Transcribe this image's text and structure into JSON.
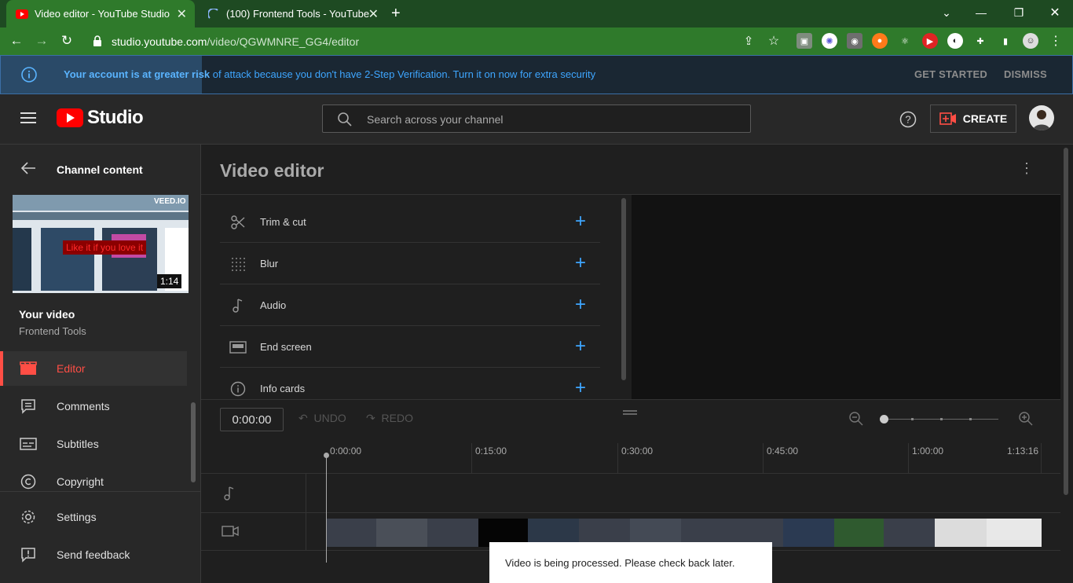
{
  "browser": {
    "tabs": [
      {
        "title": "Video editor - YouTube Studio",
        "active": true
      },
      {
        "title": "(100) Frontend Tools - YouTube",
        "active": false
      }
    ],
    "url_host": "studio.youtube.com",
    "url_path": "/video/QGWMNRE_GG4/editor"
  },
  "banner": {
    "strong": "Your account is at greater risk",
    "rest": " of attack because you don't have 2-Step Verification. Turn it on now for extra security",
    "get_started": "GET STARTED",
    "dismiss": "DISMISS"
  },
  "header": {
    "logo_text": "Studio",
    "search_placeholder": "Search across your channel",
    "create_label": "CREATE"
  },
  "sidebar": {
    "back_title": "Channel content",
    "thumb_brand": "VEED.IO",
    "thumb_overlay": "Like it if you love it",
    "thumb_duration": "1:14",
    "video_label": "Your video",
    "channel_name": "Frontend Tools",
    "items": [
      {
        "label": "Editor",
        "icon": "editor-icon",
        "active": true
      },
      {
        "label": "Comments",
        "icon": "comments-icon",
        "active": false
      },
      {
        "label": "Subtitles",
        "icon": "subtitles-icon",
        "active": false
      },
      {
        "label": "Copyright",
        "icon": "copyright-icon",
        "active": false
      },
      {
        "label": "Settings",
        "icon": "gear-icon",
        "active": false
      },
      {
        "label": "Send feedback",
        "icon": "feedback-icon",
        "active": false
      }
    ]
  },
  "main": {
    "title": "Video editor",
    "tools": [
      {
        "label": "Trim & cut",
        "icon": "scissors-icon"
      },
      {
        "label": "Blur",
        "icon": "blur-grid-icon"
      },
      {
        "label": "Audio",
        "icon": "music-note-icon"
      },
      {
        "label": "End screen",
        "icon": "end-screen-icon"
      },
      {
        "label": "Info cards",
        "icon": "info-icon"
      }
    ],
    "timecode": "0:00:00",
    "undo_label": "UNDO",
    "redo_label": "REDO",
    "ruler": [
      "0:00:00",
      "0:15:00",
      "0:30:00",
      "0:45:00",
      "1:00:00",
      "1:13:16"
    ]
  },
  "toast": "Video is being processed. Please check back later.",
  "colors": {
    "accent": "#3ea6ff",
    "brand_red": "#ff0000",
    "active_red": "#ff4e45",
    "chrome_green": "#2f7a2b"
  }
}
